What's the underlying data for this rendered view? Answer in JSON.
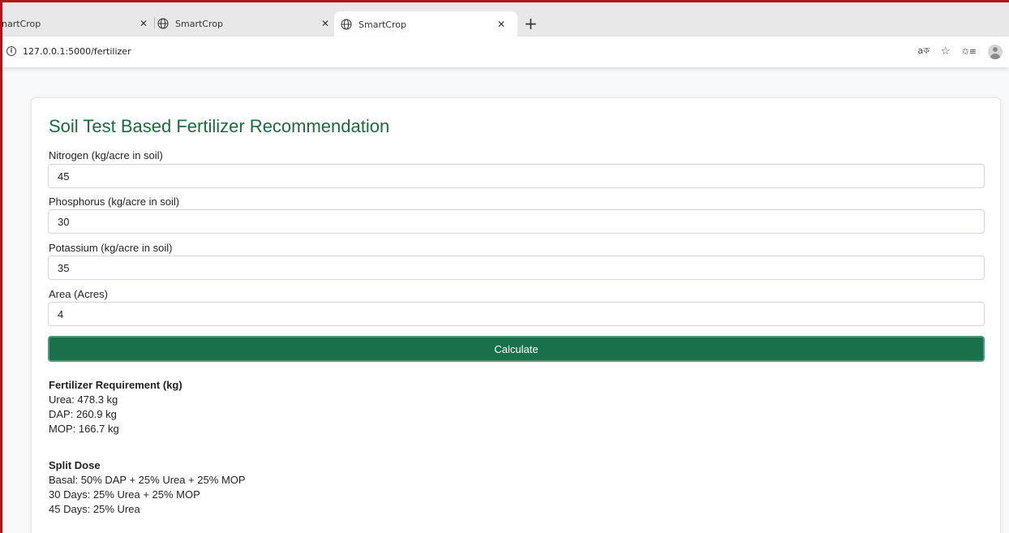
{
  "browser": {
    "tabs": [
      {
        "label": "nartCrop",
        "close": "✕"
      },
      {
        "label": "SmartCrop",
        "close": "✕"
      },
      {
        "label": "SmartCrop",
        "close": "✕"
      }
    ],
    "new_tab": "+",
    "address": "127.0.0.1:5000/fertilizer",
    "info_glyph": "i",
    "translate_glyph": "aক",
    "bookmark_glyph": "☆",
    "favorites_glyph": "✩≡"
  },
  "page": {
    "title": "Soil Test Based Fertilizer Recommendation",
    "fields": [
      {
        "label": "Nitrogen (kg/acre in soil)",
        "value": "45"
      },
      {
        "label": "Phosphorus (kg/acre in soil)",
        "value": "30"
      },
      {
        "label": "Potassium (kg/acre in soil)",
        "value": "35"
      },
      {
        "label": "Area (Acres)",
        "value": "4"
      }
    ],
    "calculate_label": "Calculate",
    "requirement": {
      "heading": "Fertilizer Requirement (kg)",
      "lines": [
        "Urea: 478.3 kg",
        "DAP: 260.9 kg",
        "MOP: 166.7 kg"
      ]
    },
    "split": {
      "heading": "Split Dose",
      "lines": [
        "Basal: 50% DAP + 25% Urea + 25% MOP",
        "30 Days: 25% Urea + 25% MOP",
        "45 Days: 25% Urea"
      ]
    }
  },
  "colors": {
    "accent_green": "#18714a",
    "title_green": "#1d6b3c",
    "frame_red": "#b3121b"
  }
}
